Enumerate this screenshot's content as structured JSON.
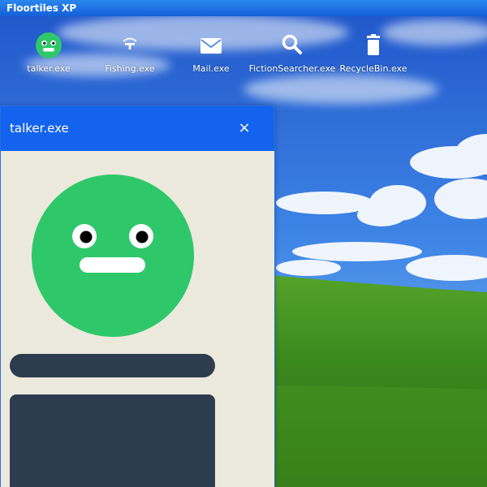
{
  "top_bar": {
    "title": "Floortiles XP"
  },
  "desktop_icons": [
    {
      "label": "talker.exe",
      "icon": "smiley-face-icon"
    },
    {
      "label": "Fishing.exe",
      "icon": "fishing-hook-icon"
    },
    {
      "label": "Mail.exe",
      "icon": "envelope-icon"
    },
    {
      "label": "FictionSearcher.exe",
      "icon": "magnifier-icon"
    },
    {
      "label": "RecycleBin.exe",
      "icon": "trash-can-icon"
    }
  ],
  "window": {
    "title": "talker.exe",
    "close_glyph": "×",
    "face_color": "#2ec86a",
    "panel_color": "#2e3c4f"
  },
  "colors": {
    "title_bar": "#1463ee",
    "window_bg": "#ece9dd",
    "top_bar": "#1f6fe4"
  }
}
